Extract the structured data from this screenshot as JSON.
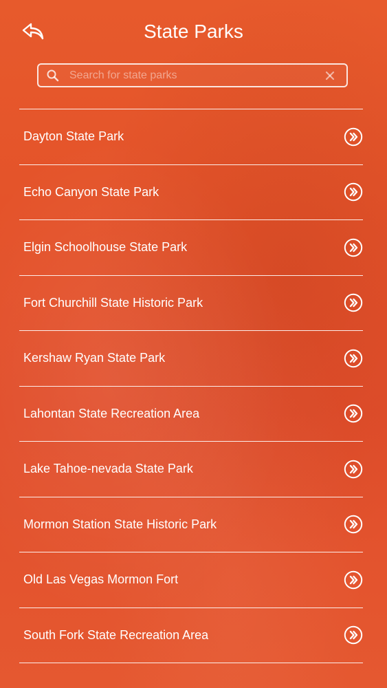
{
  "header": {
    "title": "State Parks",
    "back_icon": "reply-arrow-icon"
  },
  "search": {
    "placeholder": "Search for state parks",
    "value": "",
    "search_icon": "magnifier-icon",
    "clear_icon": "close-icon"
  },
  "parks": [
    {
      "label": "Dayton State Park"
    },
    {
      "label": "Echo Canyon State Park"
    },
    {
      "label": "Elgin Schoolhouse State Park"
    },
    {
      "label": "Fort Churchill State Historic Park"
    },
    {
      "label": "Kershaw Ryan State Park"
    },
    {
      "label": "Lahontan State Recreation Area"
    },
    {
      "label": "Lake Tahoe-nevada State Park"
    },
    {
      "label": "Mormon Station State Historic Park"
    },
    {
      "label": "Old Las Vegas Mormon Fort"
    },
    {
      "label": "South Fork State Recreation Area"
    }
  ],
  "colors": {
    "background": "#e4532a",
    "text": "#ffffff",
    "divider": "#ffffff"
  }
}
